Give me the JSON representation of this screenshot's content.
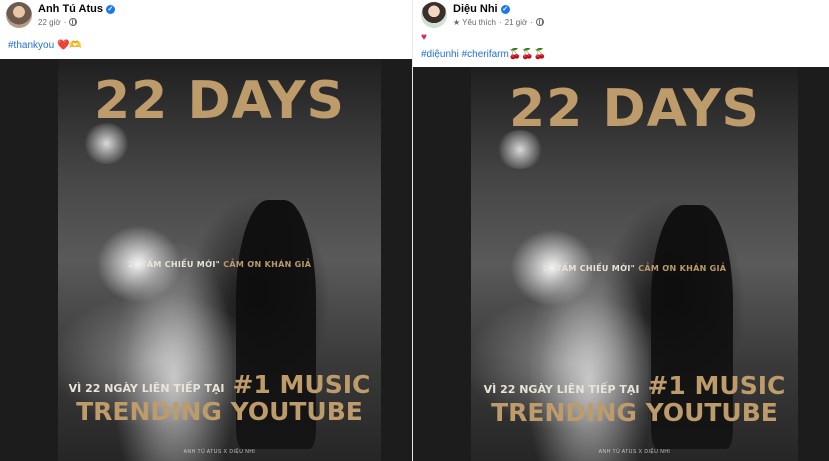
{
  "left_post": {
    "author": "Anh Tú Atus",
    "time": "22 giờ",
    "caption_tag": "#thankyou",
    "caption_emoji": "❤️🫶"
  },
  "right_post": {
    "author": "Diệu Nhi",
    "favorite_label": "Yêu thích",
    "time": "21 giờ",
    "caption_line1": "♥",
    "caption_tags": "#diệunhi #cherifarm",
    "caption_emoji": "🍒🍒🍒"
  },
  "poster": {
    "headline": "22 DAYS",
    "thanks_prefix": "2 \"TẤM CHIẾU MỚI\"",
    "thanks_suffix": "CẢM ƠN KHÁN GIẢ",
    "line_vi": "VÌ 22 NGÀY LIÊN TIẾP TẠI",
    "line_music": "#1 MUSIC",
    "line_trending": "TRENDING YOUTUBE",
    "credit": "ANH TÚ ATUS X DIỆU NHI"
  },
  "colors": {
    "link": "#216fdb",
    "gold": "#bd9b6a",
    "verified": "#1877f2"
  }
}
